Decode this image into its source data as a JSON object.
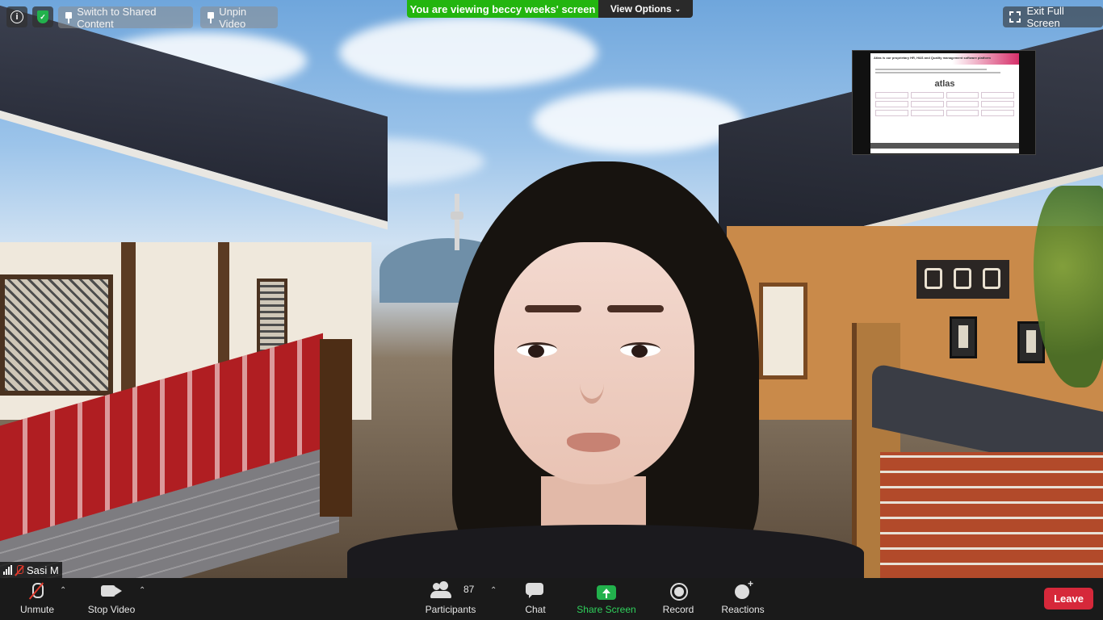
{
  "top_bar": {
    "info_icon": "info-icon",
    "security_icon": "shield-icon",
    "switch_shared_label": "Switch to Shared Content",
    "unpin_video_label": "Unpin Video",
    "viewing_message": "You are viewing beccy weeks' screen",
    "view_options_label": "View Options",
    "exit_fullscreen_label": "Exit Full Screen"
  },
  "shared_thumbnail": {
    "heading": "Atlas is our proprietary HR, H&S and Quality management software platform",
    "logo_text": "atlas"
  },
  "participant": {
    "name": "Sasi M",
    "muted": true
  },
  "toolbar": {
    "unmute_label": "Unmute",
    "stop_video_label": "Stop Video",
    "participants_label": "Participants",
    "participants_count": "87",
    "chat_label": "Chat",
    "share_screen_label": "Share Screen",
    "record_label": "Record",
    "reactions_label": "Reactions",
    "leave_label": "Leave"
  },
  "colors": {
    "viewing_banner": "#23b50f",
    "share_screen_accent": "#22b14c",
    "leave_button": "#d6283a",
    "toolbar_bg": "#1a1a1a"
  }
}
